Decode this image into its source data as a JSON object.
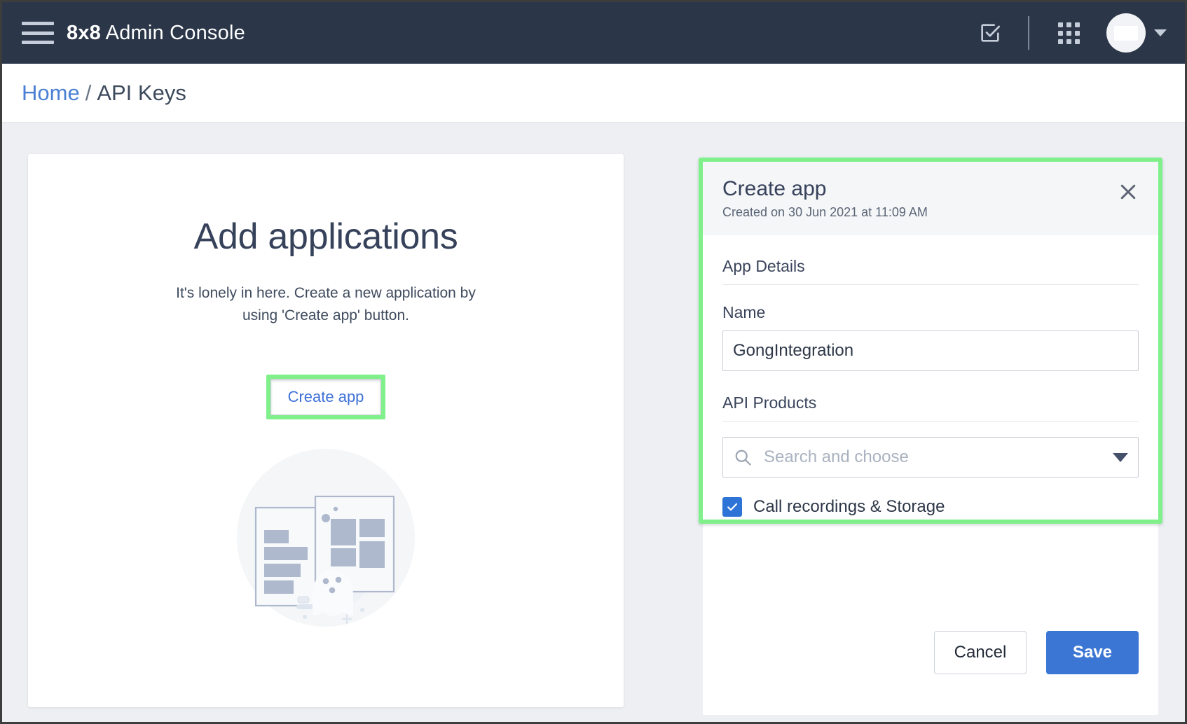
{
  "topbar": {
    "menu_icon": "hamburger-icon",
    "brand_bold": "8x8",
    "brand_rest": " Admin Console",
    "tasks_icon": "checkbox-task-icon",
    "apps_icon": "app-grid-icon",
    "avatar_icon": "user-avatar",
    "caret_icon": "chevron-down-icon"
  },
  "breadcrumb": {
    "home": "Home",
    "separator": "/",
    "current": "API Keys"
  },
  "empty_state": {
    "title": "Add applications",
    "description": "It's lonely in here. Create a new application by using 'Create app' button.",
    "create_button": "Create app",
    "illustration": "empty-apps-ghost-illustration",
    "highlight_color": "#7ff08a",
    "link_color": "#3f72d8"
  },
  "panel": {
    "title": "Create app",
    "subtitle": "Created on 30 Jun 2021 at 11:09 AM",
    "close_icon": "close-icon",
    "highlight_color": "#7ff08a",
    "app_details": {
      "section_label": "App Details",
      "name_label": "Name",
      "name_value": "GongIntegration"
    },
    "api_products": {
      "section_label": "API Products",
      "search_placeholder": "Search and choose",
      "search_value": "",
      "search_icon": "search-icon",
      "dropdown_icon": "caret-down-icon",
      "options": [
        {
          "label": "Call recordings & Storage",
          "checked": true
        }
      ]
    },
    "footer": {
      "cancel_label": "Cancel",
      "save_label": "Save",
      "save_color": "#3b76d4"
    }
  }
}
